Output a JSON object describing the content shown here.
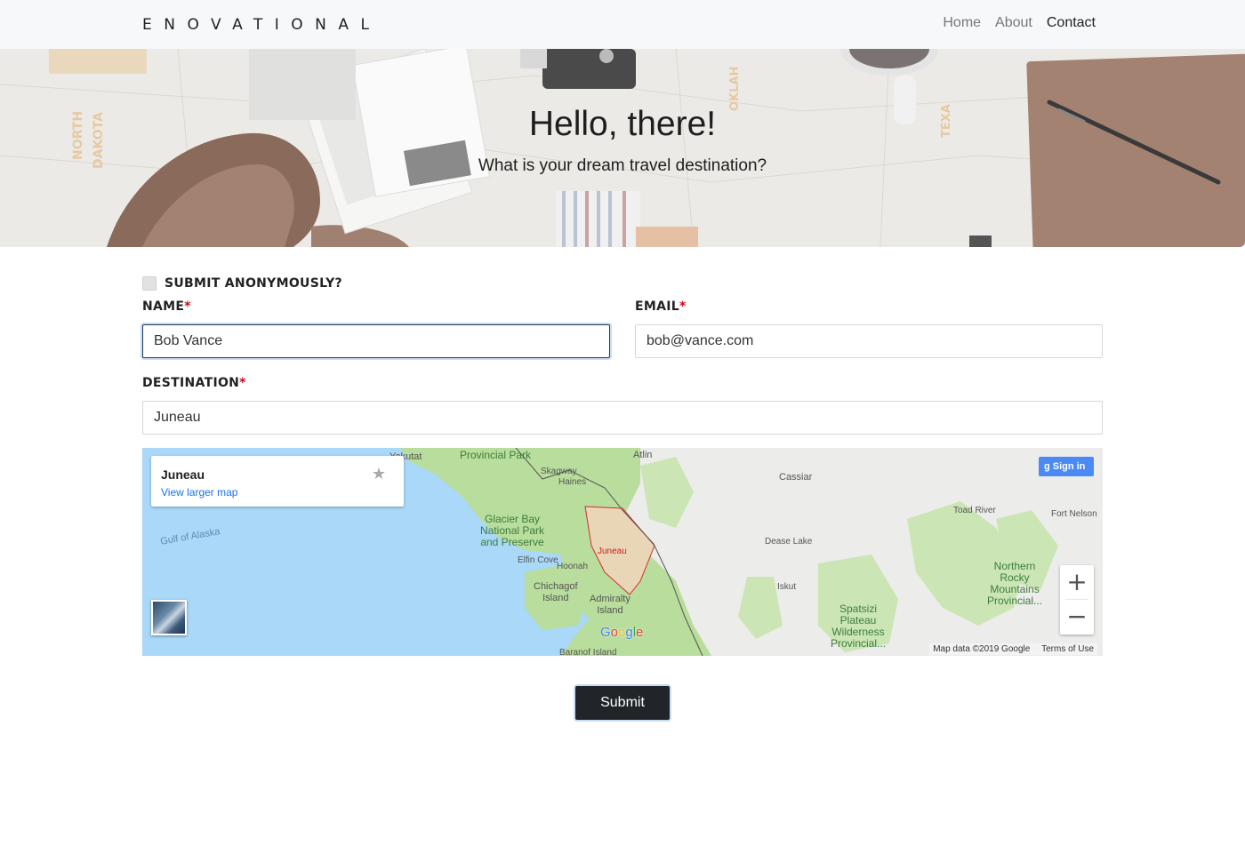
{
  "nav": {
    "brand": "ENOVATIONAL",
    "links": [
      "Home",
      "About",
      "Contact"
    ],
    "active": "Contact"
  },
  "hero": {
    "title": "Hello, there!",
    "subtitle": "What is your dream travel destination?"
  },
  "form": {
    "anonymous_label": "SUBMIT ANONYMOUSLY?",
    "anonymous_checked": false,
    "name_label": "NAME",
    "name_value": "Bob Vance",
    "email_label": "EMAIL",
    "email_value": "bob@vance.com",
    "destination_label": "DESTINATION",
    "destination_value": "Juneau",
    "required_marker": "*",
    "submit_label": "Submit"
  },
  "map": {
    "place_title": "Juneau",
    "larger_map_link": "View larger map",
    "sign_in": "Sign in",
    "zoom_in": "+",
    "zoom_out": "−",
    "attribution": "Map data ©2019 Google",
    "terms": "Terms of Use",
    "labels": {
      "yakutat": "Yakutat",
      "provincial_park": "Provincial Park",
      "atlin": "Atlin",
      "skagway": "Skagway",
      "haines": "Haines",
      "cassiar": "Cassiar",
      "glacier_bay": "Glacier Bay\nNational Park\nand Preserve",
      "gulf": "Gulf of Alaska",
      "elfin_cove": "Elfin Cove",
      "hoonah": "Hoonah",
      "juneau": "Juneau",
      "chichagof": "Chichagof\nIsland",
      "admiralty": "Admiralty\nIsland",
      "baranof": "Baranof Island",
      "toad_river": "Toad River",
      "fort_nelson": "Fort Nelson",
      "dease_lake": "Dease Lake",
      "iskut": "Iskut",
      "northern_rocky": "Northern\nRocky\nMountains\nProvincial...",
      "spatsizi": "Spatsizi\nPlateau\nWilderness\nProvincial..."
    }
  },
  "colors": {
    "primary_button": "#212529",
    "required": "#d0021b",
    "focus_border": "#233c5c",
    "map_water": "#a9d8f8",
    "map_land": "#b8dd9c",
    "signin_blue": "#4a8af4"
  }
}
